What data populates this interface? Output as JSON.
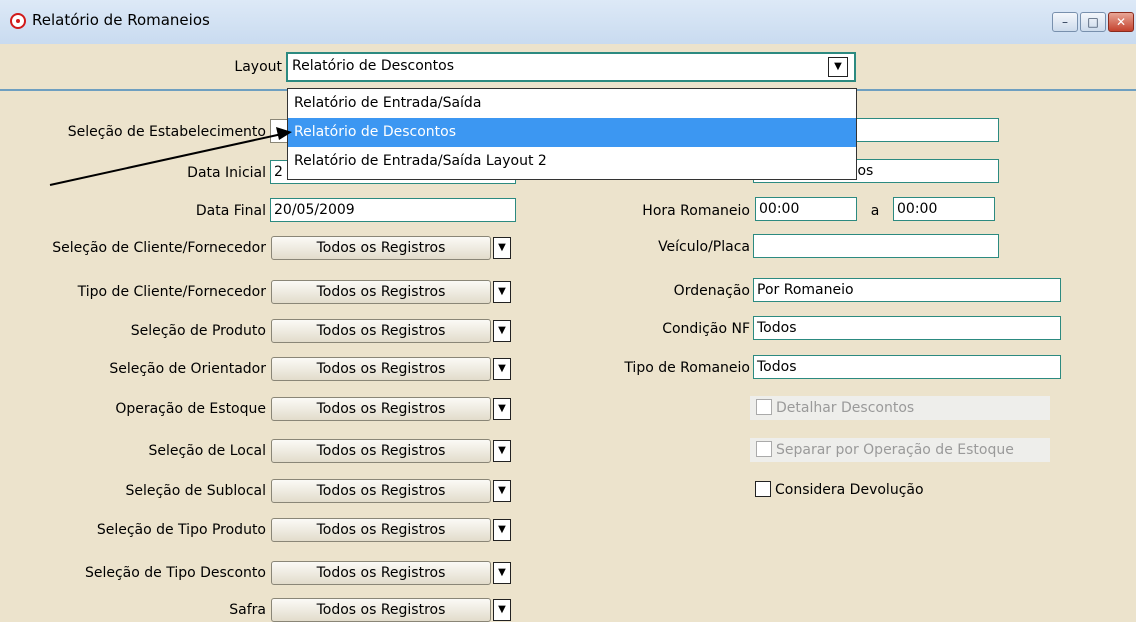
{
  "window": {
    "title": "Relatório de Romaneios",
    "buttons": [
      "minimize",
      "maximize",
      "close"
    ]
  },
  "layout": {
    "label": "Layout",
    "value": "Relatório de Descontos",
    "options": [
      "Relatório de Entrada/Saída",
      "Relatório de Descontos",
      "Relatório de Entrada/Saída Layout 2"
    ],
    "selected_index": 1
  },
  "left_fields": {
    "estabelecimento": {
      "label": "Seleção de Estabelecimento",
      "value": ""
    },
    "data_inicial": {
      "label": "Data Inicial",
      "value": "2"
    },
    "data_final": {
      "label": "Data Final",
      "value": "20/05/2009"
    }
  },
  "selectors": [
    {
      "label": "Seleção de Cliente/Fornecedor",
      "value": "Todos os Registros"
    },
    {
      "label": "Tipo de Cliente/Fornecedor",
      "value": "Todos os Registros"
    },
    {
      "label": "Seleção de Produto",
      "value": "Todos os Registros"
    },
    {
      "label": "Seleção de Orientador",
      "value": "Todos os Registros"
    },
    {
      "label": "Operação de Estoque",
      "value": "Todos os Registros"
    },
    {
      "label": "Seleção de Local",
      "value": "Todos os Registros"
    },
    {
      "label": "Seleção de Sublocal",
      "value": "Todos os Registros"
    },
    {
      "label": "Seleção de Tipo Produto",
      "value": "Todos os Registros"
    },
    {
      "label": "Seleção de Tipo Desconto",
      "value": "Todos os Registros"
    },
    {
      "label": "Safra",
      "value": "Todos os Registros"
    }
  ],
  "right_fields": {
    "partial_value": "ados",
    "hora_romaneio": {
      "label": "Hora Romaneio",
      "from": "00:00",
      "sep": "a",
      "to": "00:00"
    },
    "veiculo": {
      "label": "Veículo/Placa",
      "value": ""
    },
    "ordenacao": {
      "label": "Ordenação",
      "value": "Por Romaneio"
    },
    "condicao_nf": {
      "label": "Condição NF",
      "value": "Todos"
    },
    "tipo_romaneio": {
      "label": "Tipo de Romaneio",
      "value": "Todos"
    }
  },
  "checkboxes": [
    {
      "label": "Detalhar Descontos",
      "checked": false,
      "enabled": false
    },
    {
      "label": "Separar por Operação de Estoque",
      "checked": false,
      "enabled": false
    },
    {
      "label": "Considera Devolução",
      "checked": false,
      "enabled": true
    }
  ]
}
